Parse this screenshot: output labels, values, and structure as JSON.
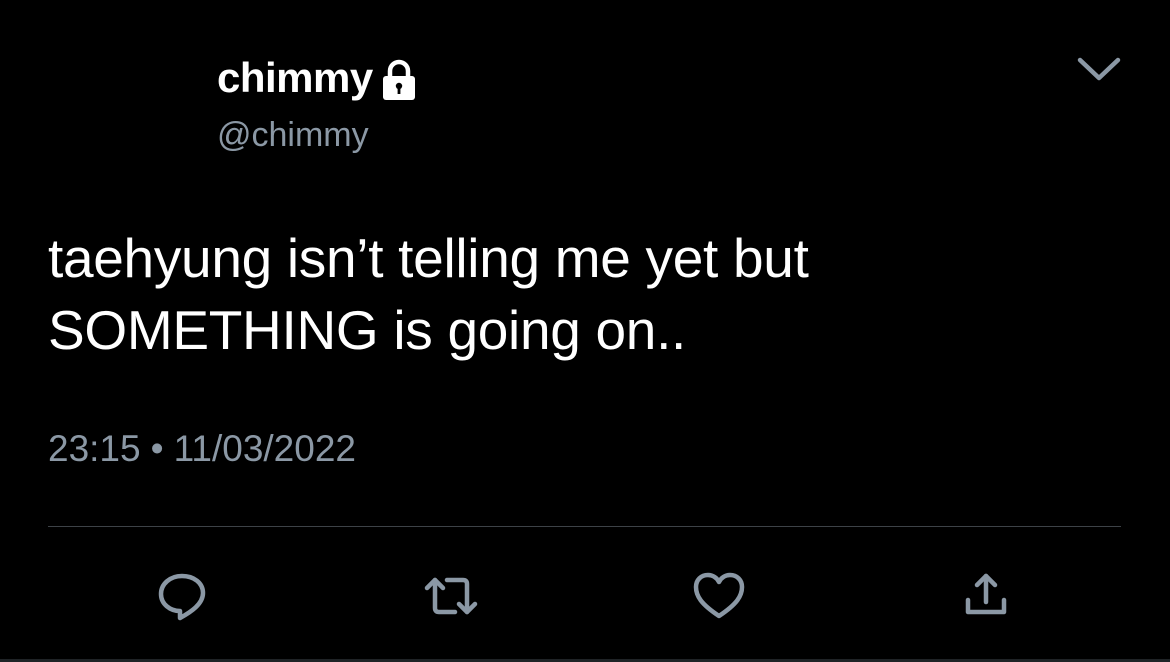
{
  "tweet": {
    "display_name": "chimmy",
    "handle": "@chimmy",
    "text_lines": [
      "taehyung isn’t telling me yet but",
      "SOMETHING is going on.."
    ],
    "time": "23:15",
    "separator": "•",
    "date": "11/03/2022"
  },
  "icons": {
    "protected": "lock-icon",
    "menu": "chevron-down-icon",
    "reply": "reply-icon",
    "retweet": "retweet-icon",
    "like": "heart-icon",
    "share": "share-icon"
  },
  "colors": {
    "background": "#000000",
    "primary_text": "#ffffff",
    "secondary_text": "#8b98a5",
    "divider": "#3d4247"
  }
}
